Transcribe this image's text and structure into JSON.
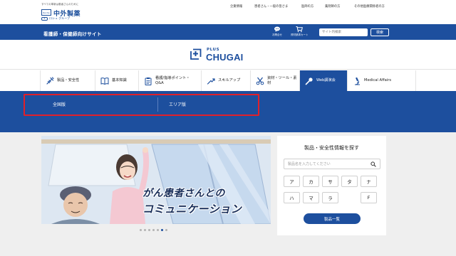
{
  "header": {
    "tagline": "すべての革新は患者さんのために",
    "company_name": "中外製薬",
    "roche_label": "Roche",
    "group_label": "ロシュ グループ",
    "top_links": [
      "企業情報",
      "患者さん・一般の皆さま",
      "医師の方",
      "薬剤師の方",
      "その他医療関係者の方"
    ],
    "site_label": "看護師・保健師向けサイト",
    "icons": [
      {
        "name": "inquiry-icon",
        "label": "お問合せ"
      },
      {
        "name": "cart-icon",
        "label": "資材請求カート"
      }
    ],
    "search_placeholder": "サイト内検索",
    "search_button": "検索"
  },
  "brand": {
    "plus": "PLUS",
    "chugai": "CHUGAI"
  },
  "nav": {
    "items": [
      {
        "label": "製品・安全性",
        "icon": "syringe-icon"
      },
      {
        "label": "基本知識",
        "icon": "book-icon"
      },
      {
        "label": "看護/指導ポイント・Q&A",
        "icon": "clipboard-icon"
      },
      {
        "label": "スキルアップ",
        "icon": "arrow-up-icon"
      },
      {
        "label": "資材・ツール・素材",
        "icon": "scissors-icon"
      },
      {
        "label": "Web講演会",
        "icon": "microphone-icon",
        "active": true
      },
      {
        "label": "Medical Affairs",
        "icon": "microscope-icon"
      }
    ]
  },
  "dropdown": {
    "items": [
      "全国版",
      "エリア版"
    ]
  },
  "hero": {
    "line1": "がん患者さんとの",
    "line2": "コミュニケーション",
    "slide_count": 7,
    "active_slide": 6
  },
  "product_search": {
    "title": "製品・安全性情報を探す",
    "placeholder": "製品名を入力してください",
    "kana": [
      "ア",
      "カ",
      "サ",
      "タ",
      "ナ",
      "ハ",
      "マ",
      "ラ",
      "",
      "F"
    ],
    "list_button": "製品一覧"
  },
  "colors": {
    "brand_blue": "#1d4f9e",
    "highlight_red": "#e1202a",
    "background_gray": "#efefef"
  }
}
